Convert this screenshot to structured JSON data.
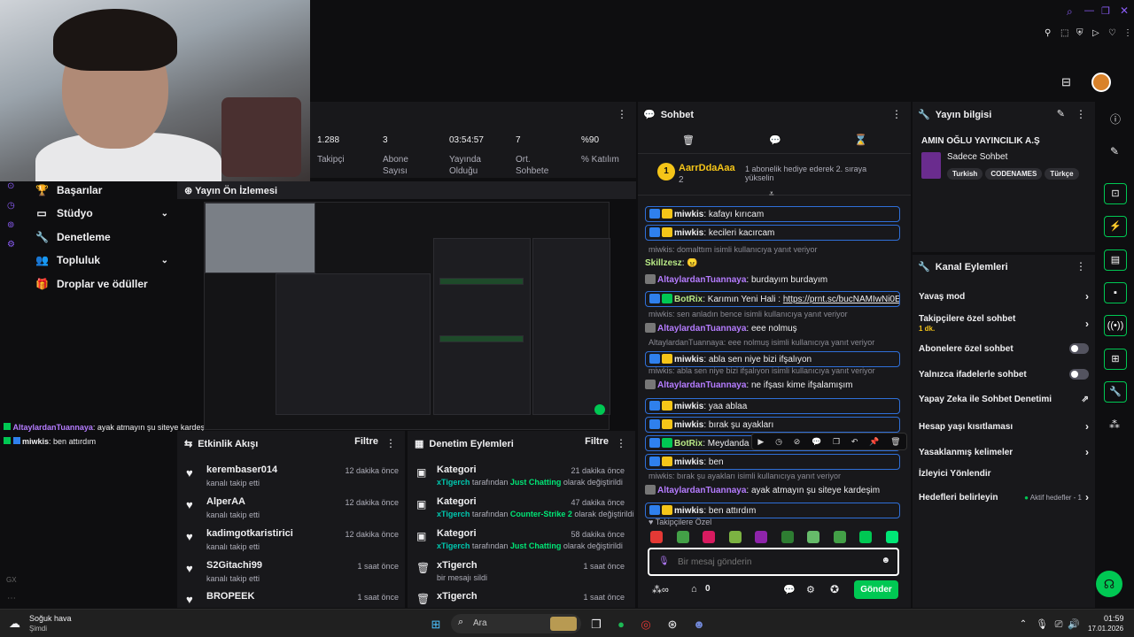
{
  "stats": [
    {
      "value": "1.288",
      "label1": "Takipçi",
      "label2": ""
    },
    {
      "value": "3",
      "label1": "Abone",
      "label2": "Sayısı"
    },
    {
      "value": "03:54:57",
      "label1": "Yayında",
      "label2": "Olduğu"
    },
    {
      "value": "7",
      "label1": "Ort.",
      "label2": "Sohbete"
    },
    {
      "value": "%90",
      "label1": "% Katılım",
      "label2": ""
    }
  ],
  "left_nav": {
    "items": [
      {
        "label": "Başarılar",
        "icon": "trophy-icon"
      },
      {
        "label": "Stüdyo",
        "icon": "studio-icon"
      },
      {
        "label": "Denetleme",
        "icon": "wrench-icon"
      },
      {
        "label": "Topluluk",
        "icon": "community-icon"
      },
      {
        "label": "Droplar ve ödüller",
        "icon": "gift-icon"
      }
    ],
    "rail_label": "GX"
  },
  "overlay_chat": [
    {
      "user": "AltaylardanTuannaya",
      "text": ": ayak atmayın şu siteye kardeşim"
    },
    {
      "user": "miwkis",
      "text": ": ben attırdım"
    }
  ],
  "preview": {
    "title": "Yayın Ön İzlemesi"
  },
  "activity": {
    "title": "Etkinlik Akışı",
    "filter": "Filtre",
    "items": [
      {
        "name": "kerembaser014",
        "sub": "kanalı takip etti",
        "time": "12 dakika önce"
      },
      {
        "name": "AlperAA",
        "sub": "kanalı takip etti",
        "time": "12 dakika önce"
      },
      {
        "name": "kadimgotkaristirici",
        "sub": "kanalı takip etti",
        "time": "12 dakika önce"
      },
      {
        "name": "S2Gitachi99",
        "sub": "kanalı takip etti",
        "time": "1 saat önce"
      },
      {
        "name": "BROPEEK",
        "sub": "",
        "time": "1 saat önce"
      }
    ]
  },
  "moderation": {
    "title": "Denetim Eylemleri",
    "filter": "Filtre",
    "items": [
      {
        "name": "Kategori",
        "user": "xTigerch",
        "mid": " tarafından ",
        "value": "Just Chatting",
        "end": " olarak değiştirildi",
        "time": "21 dakika önce"
      },
      {
        "name": "Kategori",
        "user": "xTigerch",
        "mid": " tarafından ",
        "value": "Counter-Strike 2",
        "end": " olarak değiştirildi",
        "time": "47 dakika önce"
      },
      {
        "name": "Kategori",
        "user": "xTigerch",
        "mid": " tarafından ",
        "value": "Just Chatting",
        "end": " olarak değiştirildi",
        "time": "58 dakika önce"
      },
      {
        "name": "xTigerch",
        "user": "",
        "mid": "bir mesajı sildi",
        "value": "",
        "end": "",
        "time": "1 saat önce"
      },
      {
        "name": "xTigerch",
        "user": "",
        "mid": "",
        "value": "",
        "end": "",
        "time": "1 saat önce"
      }
    ]
  },
  "chat": {
    "title": "Sohbet",
    "pinned": {
      "user": "AarrDdaAaa",
      "count": "2",
      "rank": "1",
      "text": "1 abonelik hediye ederek 2. sıraya yükselin"
    },
    "messages": [
      {
        "type": "msg",
        "boxed": true,
        "badges": [
          "b-blue",
          "b-gold"
        ],
        "user": "miwkis",
        "ucls": "u1",
        "text": ": kafayı kırıcam"
      },
      {
        "type": "msg",
        "boxed": true,
        "badges": [
          "b-blue",
          "b-gold"
        ],
        "user": "miwkis",
        "ucls": "u1",
        "text": ": kecileri kacırcam"
      },
      {
        "type": "reply",
        "text": "miwkis: domalttım isimli kullanıcıya yanıt veriyor"
      },
      {
        "type": "msg",
        "boxed": false,
        "badges": [],
        "user": "Skillzesz",
        "ucls": "u3",
        "text": ": 😠"
      },
      {
        "type": "msg",
        "boxed": false,
        "badges": [
          "b-wolf"
        ],
        "user": "AltaylardanTuannaya",
        "ucls": "u2",
        "text": ": burdayım burdayım"
      },
      {
        "type": "msg",
        "boxed": true,
        "badges": [
          "b-blue",
          "b-green"
        ],
        "user": "BotRix",
        "ucls": "u3",
        "text": ": Karımın Yeni Hali : ",
        "link": "https://prnt.sc/bucNAMIwNi0E"
      },
      {
        "type": "reply",
        "text": "miwkis: sen anladın bence isimli kullanıcıya yanıt veriyor"
      },
      {
        "type": "msg",
        "boxed": false,
        "badges": [
          "b-wolf"
        ],
        "user": "AltaylardanTuannaya",
        "ucls": "u2",
        "text": ": eee nolmuş"
      },
      {
        "type": "reply",
        "text": "AltaylardanTuannaya: eee nolmuş isimli kullanıcıya yanıt veriyor"
      },
      {
        "type": "msg",
        "boxed": true,
        "badges": [
          "b-blue",
          "b-gold"
        ],
        "user": "miwkis",
        "ucls": "u1",
        "text": ": abla sen niye bizi ifşalıyon"
      },
      {
        "type": "reply",
        "text": "miwkis: abla sen niye bizi ifşalıyon isimli kullanıcıya yanıt veriyor"
      },
      {
        "type": "msg",
        "boxed": false,
        "badges": [
          "b-wolf"
        ],
        "user": "AltaylardanTuannaya",
        "ucls": "u2",
        "text": ": ne ifşası kime ifşalamışım"
      },
      {
        "type": "msg",
        "boxed": true,
        "badges": [
          "b-blue",
          "b-gold"
        ],
        "user": "miwkis",
        "ucls": "u1",
        "text": ": yaa ablaa"
      },
      {
        "type": "msg",
        "boxed": true,
        "badges": [
          "b-blue",
          "b-gold"
        ],
        "user": "miwkis",
        "ucls": "u1",
        "text": ": bırak şu ayakları"
      },
      {
        "type": "msg",
        "boxed": true,
        "badges": [
          "b-blue",
          "b-green"
        ],
        "user": "BotRix",
        "ucls": "u3",
        "text": ": Meydanda DO"
      },
      {
        "type": "msg",
        "boxed": true,
        "badges": [
          "b-blue",
          "b-gold"
        ],
        "user": "miwkis",
        "ucls": "u1",
        "text": ": ben"
      },
      {
        "type": "reply",
        "text": "miwkis: bırak şu ayakları isimli kullanıcıya yanıt veriyor"
      },
      {
        "type": "msg",
        "boxed": false,
        "badges": [
          "b-wolf"
        ],
        "user": "AltaylardanTuannaya",
        "ucls": "u2",
        "text": ": ayak atmayın şu siteye kardeşim"
      },
      {
        "type": "msg",
        "boxed": true,
        "badges": [
          "b-blue",
          "b-gold"
        ],
        "user": "miwkis",
        "ucls": "u1",
        "text": ": ben attırdım"
      }
    ],
    "emote_label": "Takipçilere Özel",
    "input_placeholder": "Bir mesaj gönderin",
    "points": "0",
    "send_label": "Gönder"
  },
  "stream_info": {
    "title": "Yayın bilgisi",
    "stream_title": "AMIN OĞLU YAYINCILIK A.Ş",
    "mode": "Sadece Sohbet",
    "tags": [
      "Turkish",
      "CODENAMES",
      "Türkçe"
    ]
  },
  "channel_actions": {
    "title": "Kanal Eylemleri",
    "slow_mode": "Yavaş mod",
    "followers_only": "Takipçilere özel sohbet",
    "followers_only_value": "1 dk.",
    "subs_only": "Abonelere özel sohbet",
    "emotes_only": "Yalnızca ifadelerle sohbet",
    "ai_mod": "Yapay Zeka ile Sohbet Denetimi",
    "age_restrict": "Hesap yaşı kısıtlaması",
    "banned_words": "Yasaklanmış kelimeler",
    "redirect": "İzleyici Yönlendir",
    "goals": "Hedefleri belirleyin",
    "goals_status": "Aktif hedefler - 1"
  },
  "taskbar": {
    "weather_title": "Soğuk hava",
    "weather_sub": "Şimdi",
    "search_placeholder": "Ara",
    "time": "01:59",
    "date": "17.01.2026"
  },
  "colors": {
    "accent": "#00c853",
    "bg": "#0e0e10",
    "panel": "#18181b"
  }
}
